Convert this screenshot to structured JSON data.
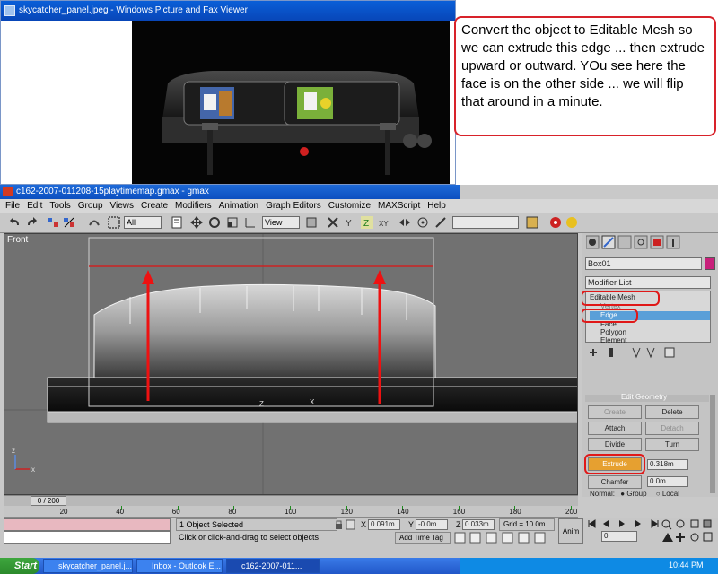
{
  "viewer": {
    "title": "skycatcher_panel.jpeg - Windows Picture and Fax Viewer"
  },
  "callout": {
    "text": "Convert the object to Editable Mesh so we can extrude this edge ... then extrude upward or outward.  YOu see here the face is on the other side ... we will flip that around in a minute."
  },
  "gmax": {
    "title": "c162-2007-011208-15playtimemap.gmax - gmax",
    "menu": [
      "File",
      "Edit",
      "Tools",
      "Group",
      "Views",
      "Create",
      "Modifiers",
      "Animation",
      "Graph Editors",
      "Customize",
      "MAXScript",
      "Help"
    ],
    "toolbar": {
      "filter": "All",
      "coord": "View"
    },
    "viewport_label": "Front",
    "command_panel": {
      "object_name": "Box01",
      "modifier_list": "Modifier List",
      "stack": [
        "Editable Mesh",
        "Vertex",
        "Edge",
        "Face",
        "Polygon",
        "Element"
      ],
      "rollout_title": "Edit Geometry",
      "buttons": [
        "Create",
        "Delete",
        "Attach",
        "Detach",
        "Divide",
        "Turn",
        "Extrude",
        "Chamfer"
      ],
      "extrude_value": "0.318m",
      "chamfer_value": "0.0m",
      "normal_label": "Normal:",
      "normal_options": [
        "Group",
        "Local"
      ]
    },
    "time_slider": "0 / 200",
    "ticks": [
      "20",
      "40",
      "60",
      "80",
      "100",
      "120",
      "140",
      "160",
      "180",
      "200"
    ],
    "status": {
      "selected": "1 Object Selected",
      "prompt": "Click or click-and-drag to select objects",
      "x_label": "X",
      "x_value": "0.091m",
      "y_label": "Y",
      "y_value": "-0.0m",
      "z_label": "Z",
      "z_value": "0.033m",
      "grid": "Grid = 10.0m",
      "add_time_tag": "Add Time Tag",
      "anim_label": "Anim",
      "frame": "0"
    }
  },
  "taskbar": {
    "start": "Start",
    "tasks": [
      "skycatcher_panel.j...",
      "Inbox - Outlook E...",
      "c162-2007-011..."
    ],
    "clock": "10:44 PM"
  }
}
